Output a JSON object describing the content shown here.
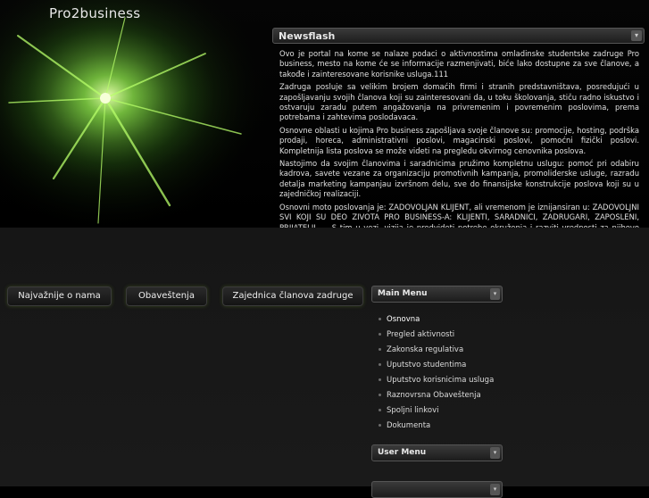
{
  "site": {
    "title": "Pro2business"
  },
  "newsflash": {
    "title": "Newsflash",
    "paragraphs": [
      "Ovo je portal na kome se nalaze podaci o aktivnostima omladinske studentske zadruge Pro business, mesto na kome će se informacije razmenjivati, biće lako dostupne za sve članove, a takođe i zainteresovane korisnike usluga.111",
      "Zadruga posluje sa velikim brojem domaćih firmi i stranih predstavništava, posredujući u zapošljavanju svojih članova koji su zainteresovani da, u toku školovanja, stiču radno iskustvo i ostvaruju zaradu putem angažovanja na privremenim i povremenim poslovima, prema potrebama i zahtevima poslodavaca.",
      "Osnovne oblasti u kojima Pro business zapošljava svoje članove su: promocije, hosting, podrška prodaji, horeca, administrativni poslovi, magacinski poslovi, pomoćni fizički poslovi. Kompletnija lista poslova se može videti na pregledu okvirnog cenovnika poslova.",
      "Nastojimo da svojim članovima i saradnicima pružimo kompletnu uslugu: pomoć pri odabiru kadrova, savete vezane za organizaciju promotivnih kampanja, promoliderske usluge, razradu detalja marketing kampanjau izvršnom delu, sve do finansijske konstrukcije poslova koji su u zajedničkoj realizaciji.",
      "Osnovni moto poslovanja je: ZADOVOLJAN KLIJENT, ali vremenom je iznijansiran u: ZADOVOLJNI SVI KOJI SU DEO ZIVOTA PRO BUSINESS-A: KLIJENTI, SARADNICI, ZADRUGARI, ZAPOSLENI, PRIJATELJI .... S tim u vezi, vizija je predvideti potrebe okruženja i razviti vrednosti za njihovo zadovoljavanje kako bismo bili spremni da na zahteve poslovnog okruzenja odgovorimo i pre nego što budu postavljeni. Predvideti probleme, prednjačiti u efikasnim rešenjima za kojima postoji potreba na tržištu, biti svež, inovativan, stimulativan, nadahnut i inspirativan. Negujemo prijateljski, neposredan, ali povrh svega profesionalan odnos sa svojim saradnicima, čineći da se na tržištu izdvojimo prepoznatljivim identitetom."
    ]
  },
  "nav": {
    "buttons": [
      "Najvažnije o nama",
      "Obaveštenja",
      "Zajednica članova zadruge"
    ]
  },
  "main_menu": {
    "title": "Main Menu",
    "items": [
      "Osnovna",
      "Pregled aktivnosti",
      "Zakonska regulativa",
      "Uputstvo studentima",
      "Uputstvo korisnicima usluga",
      "Raznovrsna Obaveštenja",
      "Spoljni linkovi",
      "Dokumenta"
    ]
  },
  "user_menu": {
    "title": "User Menu"
  },
  "icons": {
    "collapse": "chevron-icon",
    "bullet": "bullet-icon"
  }
}
